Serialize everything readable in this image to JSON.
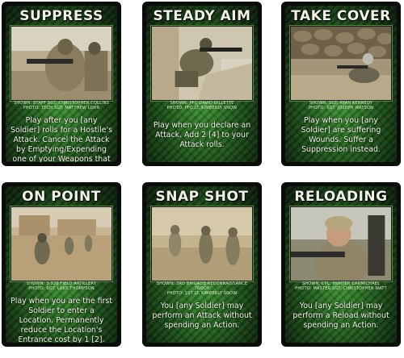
{
  "cards": [
    {
      "title": "SUPPRESS",
      "credit_shown": "SHOWN: STAFF SGT. CHRISTOPHER COLLINS",
      "credit_photo": "PHOTO: TECH SGT. MATTHEW LOHR",
      "rules": "Play after you [any Soldier] rolls for a Hostile's Attack. Cancel the Attack by Emptying/Expending one of your Weapons that can Attack the Hostile.",
      "photo_icon": "soldier-aiming-rifle-photo"
    },
    {
      "title": "STEADY AIM",
      "credit_shown": "SHOWN: PFC DAVID GILLETTE",
      "credit_photo": "PHOTO: PFC LT. KIMBERLY SNOW",
      "rules": "Play when you declare an Attack. Add 2 [4] to your Attack rolls.",
      "photo_icon": "soldier-prone-aiming-photo"
    },
    {
      "title": "TAKE COVER",
      "credit_shown": "SHOWN: SGT. RYAN KENNEDY",
      "credit_photo": "PHOTO: SGT. JOSEPH WATSON",
      "rules": "Play when you [any Soldier] are suffering Wounds. Suffer a Suppression instead.",
      "photo_icon": "soldier-behind-stone-wall-photo"
    },
    {
      "title": "ON POINT",
      "credit_shown": "SHOWN: 3-320 FIELD ARTILLERY",
      "credit_photo": "PHOTO: SGT. LUKE THOMPSON",
      "rules": "Play when you are the first Soldier to enter a Location. Permanently reduce the Location's Entrance cost by 1 [2].",
      "photo_icon": "patrol-in-village-photo"
    },
    {
      "title": "SNAP SHOT",
      "credit_shown": "SHOWN: 3RD BRIGADE RECONNAISSANCE TROOP",
      "credit_photo": "PHOTO: 1ST LT. KIMBERLY SNOW",
      "rules": "You [any Soldier] may perform an Attack without spending an Action.",
      "photo_icon": "soldiers-patrolling-dust-photo"
    },
    {
      "title": "RELOADING",
      "credit_shown": "SHOWN: CPL. HUNTER CARMICHAEL",
      "credit_photo": "PHOTO: MASTER SGT. CHRISTOPHER WATT",
      "rules": "You [any Soldier] may perform a Reload without spending an Action.",
      "photo_icon": "soldier-close-up-rifle-photo"
    }
  ]
}
